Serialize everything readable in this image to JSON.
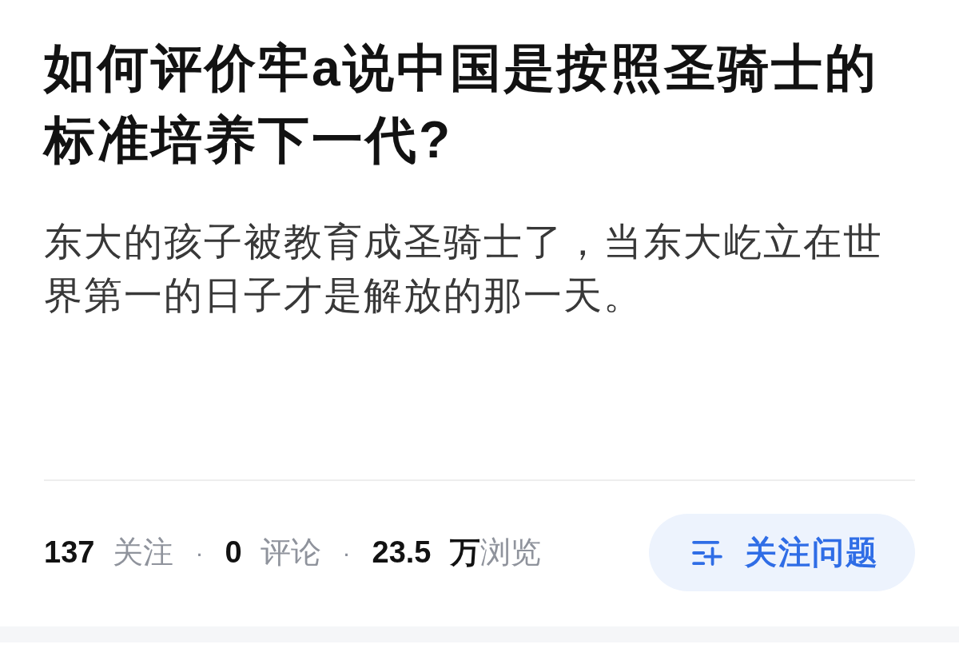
{
  "question": {
    "title": "如何评价牢a说中国是按照圣骑士的标准培养下一代?",
    "description": "东大的孩子被教育成圣骑士了，当东大屹立在世界第一的日子才是解放的那一天。"
  },
  "stats": [
    {
      "value": "137",
      "label": "关注"
    },
    {
      "separator": "·",
      "value": "0",
      "label": "评论"
    },
    {
      "separator": "·",
      "value": "23.5",
      "label": "**万**浏览"
    }
  ],
  "follow_button": {
    "label": "关注问题"
  }
}
